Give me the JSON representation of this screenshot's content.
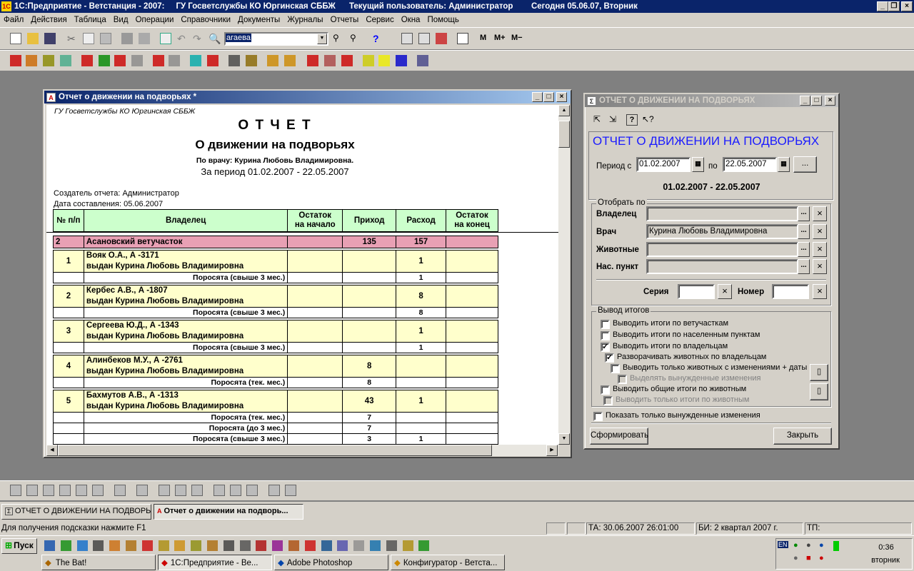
{
  "app": {
    "title": "1С:Предприятие - Ветстанция - 2007:     ГУ Госветслужбы КО Юргинская СББЖ      Текущий пользователь: Администратор        Сегодня 05.06.07, Вторник"
  },
  "menu": [
    "Файл",
    "Действия",
    "Таблица",
    "Вид",
    "Операции",
    "Справочники",
    "Документы",
    "Журналы",
    "Отчеты",
    "Сервис",
    "Окна",
    "Помощь"
  ],
  "toolbar": {
    "search_value": "агаева",
    "m_label": "M",
    "mplus_label": "M+",
    "mminus_label": "M−"
  },
  "report_window": {
    "title": "Отчет о движении на подворьях  *"
  },
  "report": {
    "org": "ГУ Госветслужбы КО Юргинская СББЖ",
    "title": "О Т Ч Е Т",
    "subtitle": "О движении на подворьях",
    "doctor": "По врачу: Курина Любовь Владимировна.",
    "period": "За период 01.02.2007  - 22.05.2007",
    "creator": "Создатель отчета: Администратор",
    "date": "Дата составления: 05.06.2007",
    "headers": {
      "num": "№ п/п",
      "owner": "Владелец",
      "start1": "Остаток",
      "start2": "на начало",
      "income": "Приход",
      "expense": "Расход",
      "end1": "Остаток",
      "end2": "на конец"
    },
    "group": {
      "num": "2",
      "name": "Асановский ветучасток",
      "income": "135",
      "expense": "157"
    },
    "entries": [
      {
        "num": "1",
        "line1": "Вояк О.А., А -3171",
        "line2": "выдан Курина Любовь Владимировна",
        "income": "",
        "expense": "1",
        "subs": [
          {
            "name": "Поросята (свыше 3 мес.)",
            "income": "",
            "expense": "1"
          }
        ]
      },
      {
        "num": "2",
        "line1": "Кербес А.В., А -1807",
        "line2": "выдан Курина Любовь Владимировна",
        "income": "",
        "expense": "8",
        "subs": [
          {
            "name": "Поросята (свыше 3 мес.)",
            "income": "",
            "expense": "8"
          }
        ]
      },
      {
        "num": "3",
        "line1": "Сергеева Ю.Д., А -1343",
        "line2": "выдан Курина Любовь Владимировна",
        "income": "",
        "expense": "1",
        "subs": [
          {
            "name": "Поросята (свыше 3 мес.)",
            "income": "",
            "expense": "1"
          }
        ]
      },
      {
        "num": "4",
        "line1": "Алинбеков М.У., А -2761",
        "line2": "выдан Курина Любовь Владимировна",
        "income": "8",
        "expense": "",
        "subs": [
          {
            "name": "Поросята (тек. мес.)",
            "income": "8",
            "expense": ""
          }
        ]
      },
      {
        "num": "5",
        "line1": "Бахмутов А.В., А -1313",
        "line2": "выдан Курина Любовь Владимировна",
        "income": "43",
        "expense": "1",
        "subs": [
          {
            "name": "Поросята (тек. мес.)",
            "income": "7",
            "expense": ""
          },
          {
            "name": "Поросята (до 3 мес.)",
            "income": "7",
            "expense": ""
          },
          {
            "name": "Поросята (свыше 3 мес.)",
            "income": "3",
            "expense": "1"
          }
        ]
      }
    ]
  },
  "form": {
    "title": "ОТЧЕТ О ДВИЖЕНИИ НА ПОДВОРЬЯХ",
    "heading": "ОТЧЕТ О ДВИЖЕНИИ НА ПОДВОРЬЯХ",
    "period_from_label": "Период с",
    "date_from": "01.02.2007",
    "to_label": "по",
    "date_to": "22.05.2007",
    "period_text": "01.02.2007 - 22.05.2007",
    "filter_group": "Отобрать по",
    "owner_label": "Владелец",
    "doctor_label": "Врач",
    "doctor_value": "Курина Любовь Владимировна",
    "animals_label": "Животные",
    "locality_label": "Нас. пункт",
    "series_label": "Серия",
    "number_label": "Номер",
    "output_group": "Вывод итогов",
    "checks": [
      {
        "label": "Выводить итоги по ветучасткам",
        "checked": false,
        "enabled": true
      },
      {
        "label": "Выводить итоги по населенным пунктам",
        "checked": false,
        "enabled": true
      },
      {
        "label": "Выводить итоги по владельцам",
        "checked": true,
        "enabled": true
      },
      {
        "label": "Разворачивать животных по владельцам",
        "checked": true,
        "enabled": true
      },
      {
        "label": "Выводить только животных с изменениями + даты",
        "checked": false,
        "enabled": true
      },
      {
        "label": "Выделять вынужденные изменения",
        "checked": false,
        "enabled": false
      },
      {
        "label": "Выводить общие итоги по животным",
        "checked": false,
        "enabled": true
      },
      {
        "label": "Выводить только итоги по животным",
        "checked": false,
        "enabled": false
      },
      {
        "label": "Показать только вынужденные изменения",
        "checked": false,
        "enabled": true
      }
    ],
    "generate_btn": "Сформировать",
    "close_btn": "Закрыть"
  },
  "window_tabs": [
    "ОТЧЕТ О ДВИЖЕНИИ НА ПОДВОРЬЯХ",
    "Отчет о движении на подворь..."
  ],
  "status": {
    "hint": "Для получения подсказки нажмите F1",
    "ta": "ТА: 30.06.2007  26:01:00",
    "bi": "БИ: 2 квартал 2007 г.",
    "tp": "ТП:"
  },
  "taskbar": {
    "start": "Пуск",
    "tasks": [
      "The Bat!",
      "1С:Предприятие - Ве...",
      "Adobe Photoshop",
      "Конфигуратор - Ветста..."
    ],
    "lang": "EN",
    "time": "0:36",
    "day": "вторник"
  }
}
